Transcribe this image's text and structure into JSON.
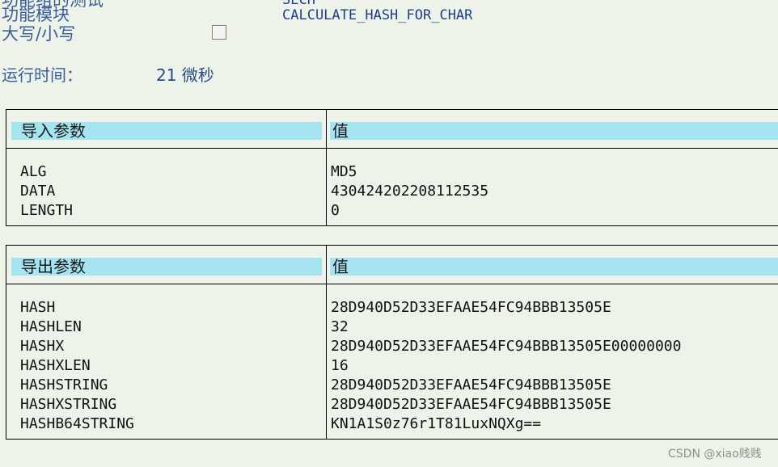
{
  "header": {
    "rows": [
      {
        "label": "功能组的测试",
        "value": "SECH"
      },
      {
        "label": "功能模块",
        "value": "CALCULATE_HASH_FOR_CHAR"
      }
    ],
    "case_label": "大写/小写",
    "case_checked": false,
    "runtime_label": "运行时间：",
    "runtime_value": "21 微秒"
  },
  "import_params": {
    "name_header": "导入参数",
    "value_header": "值",
    "rows": [
      {
        "name": "ALG",
        "value": "MD5"
      },
      {
        "name": "DATA",
        "value": "430424202208112535"
      },
      {
        "name": "LENGTH",
        "value": "0"
      }
    ]
  },
  "export_params": {
    "name_header": "导出参数",
    "value_header": "值",
    "rows": [
      {
        "name": "HASH",
        "value": "28D940D52D33EFAAE54FC94BBB13505E"
      },
      {
        "name": "HASHLEN",
        "value": "32"
      },
      {
        "name": "HASHX",
        "value": "28D940D52D33EFAAE54FC94BBB13505E00000000"
      },
      {
        "name": "HASHXLEN",
        "value": "16"
      },
      {
        "name": "HASHSTRING",
        "value": "28D940D52D33EFAAE54FC94BBB13505E"
      },
      {
        "name": "HASHXSTRING",
        "value": "28D940D52D33EFAAE54FC94BBB13505E"
      },
      {
        "name": "HASHB64STRING",
        "value": "KN1A1S0z76r1T81LuxNQXg=="
      }
    ]
  },
  "watermark": "CSDN @xiao贱贱"
}
